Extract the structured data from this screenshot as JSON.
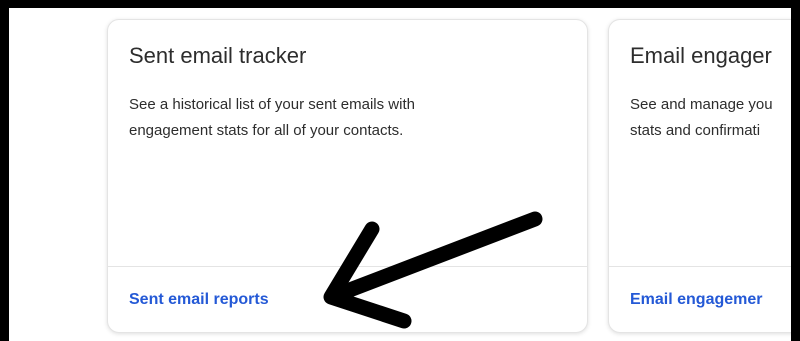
{
  "cards": [
    {
      "title": "Sent email tracker",
      "description_lines": [
        "See a historical list of your sent emails with",
        "engagement stats for all of your contacts."
      ],
      "link_label": "Sent email reports"
    },
    {
      "title": "Email engager",
      "description_lines": [
        "See and manage you",
        "stats and confirmati"
      ],
      "link_label": "Email engagemer"
    }
  ],
  "annotation": {
    "icon": "arrow-icon"
  },
  "colors": {
    "frame": "#000000",
    "link": "#2459d6",
    "text": "#2d2d2d",
    "card_border": "#e4e4e4",
    "background": "#ffffff"
  }
}
